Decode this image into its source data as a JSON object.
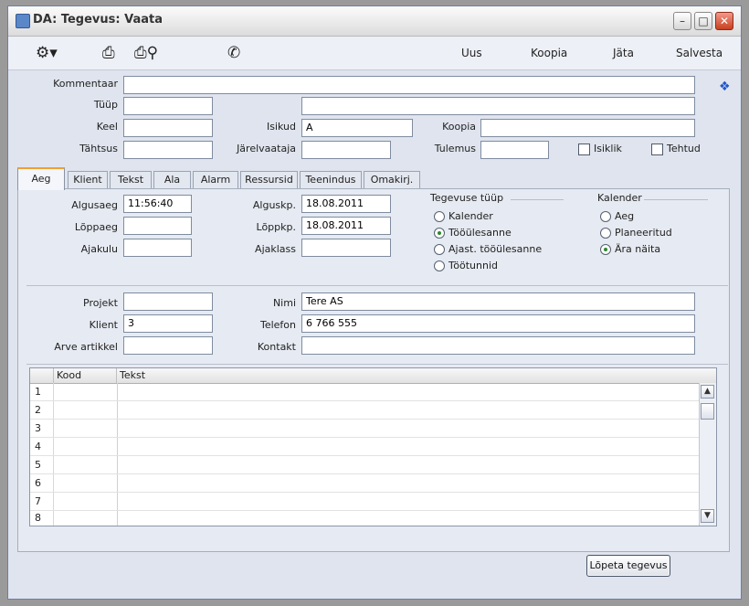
{
  "window": {
    "title": "DA: Tegevus: Vaata"
  },
  "toolbar": {
    "uus": "Uus",
    "koopia": "Koopia",
    "jata": "Jäta",
    "salvesta": "Salvesta"
  },
  "header_form": {
    "kommentaar_label": "Kommentaar",
    "kommentaar_value": "",
    "tuup_label": "Tüüp",
    "tuup_value": "",
    "tuup_desc_value": "",
    "keel_label": "Keel",
    "keel_value": "",
    "isikud_label": "Isikud",
    "isikud_value": "A",
    "koopia_label": "Koopia",
    "koopia_value": "",
    "tahtsus_label": "Tähtsus",
    "tahtsus_value": "",
    "jarelvaataja_label": "Järelvaataja",
    "jarelvaataja_value": "",
    "tulemus_label": "Tulemus",
    "tulemus_value": "",
    "isiklik_label": "Isiklik",
    "tehtud_label": "Tehtud"
  },
  "tabs": [
    {
      "label": "Aeg"
    },
    {
      "label": "Klient"
    },
    {
      "label": "Tekst"
    },
    {
      "label": "Ala"
    },
    {
      "label": "Alarm"
    },
    {
      "label": "Ressursid"
    },
    {
      "label": "Teenindus"
    },
    {
      "label": "Omakirj."
    }
  ],
  "aeg": {
    "algusaeg_label": "Algusaeg",
    "algusaeg_value": "11:56:40",
    "loppaeg_label": "Lõppaeg",
    "loppaeg_value": "",
    "ajakulu_label": "Ajakulu",
    "ajakulu_value": "",
    "alguskp_label": "Alguskp.",
    "alguskp_value": "18.08.2011",
    "loppkp_label": "Lõppkp.",
    "loppkp_value": "18.08.2011",
    "ajaklass_label": "Ajaklass",
    "ajaklass_value": "",
    "tegevuse_tuup_label": "Tegevuse tüüp",
    "tegevuse_tuup_options": [
      {
        "label": "Kalender",
        "selected": false
      },
      {
        "label": "Tööülesanne",
        "selected": true
      },
      {
        "label": "Ajast. tööülesanne",
        "selected": false
      },
      {
        "label": "Töötunnid",
        "selected": false
      }
    ],
    "kalender_label": "Kalender",
    "kalender_options": [
      {
        "label": "Aeg",
        "selected": false
      },
      {
        "label": "Planeeritud",
        "selected": false
      },
      {
        "label": "Ära näita",
        "selected": true
      }
    ],
    "projekt_label": "Projekt",
    "projekt_value": "",
    "klient_label": "Klient",
    "klient_value": "3",
    "arve_artikkel_label": "Arve artikkel",
    "arve_artikkel_value": "",
    "nimi_label": "Nimi",
    "nimi_value": "Tere AS",
    "telefon_label": "Telefon",
    "telefon_value": "6 766 555",
    "kontakt_label": "Kontakt",
    "kontakt_value": ""
  },
  "grid": {
    "columns": [
      "Kood",
      "Tekst"
    ],
    "row_numbers": [
      "1",
      "2",
      "3",
      "4",
      "5",
      "6",
      "7",
      "8"
    ]
  },
  "actions": {
    "lopeta": "Lõpeta tegevus"
  },
  "icons": [
    "gear-icon",
    "printer-icon",
    "print-preview-icon",
    "phone-icon",
    "pin-icon",
    "chevron-up-icon",
    "chevron-down-icon"
  ]
}
